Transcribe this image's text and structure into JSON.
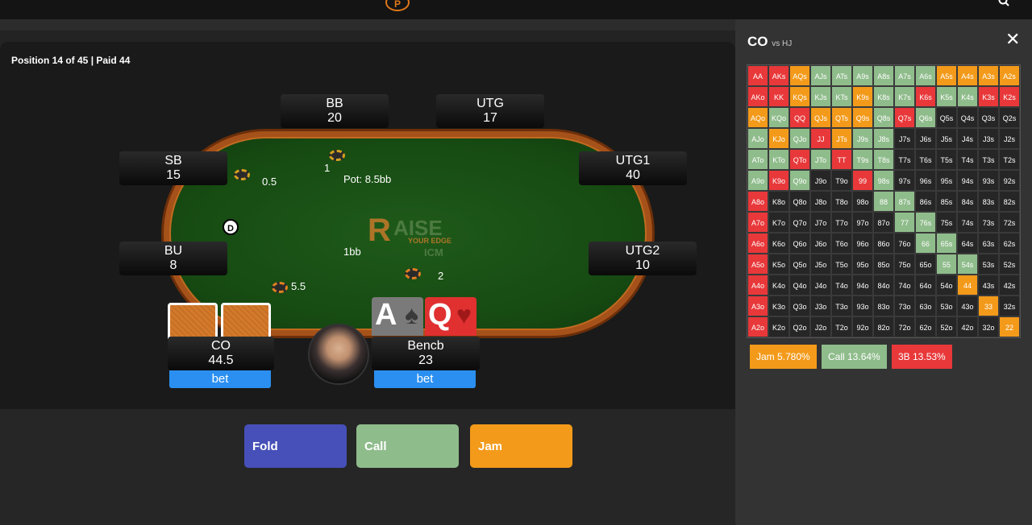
{
  "header": {
    "logo_letter": "P"
  },
  "position_info": "Position 14 of 45  |  Paid 44",
  "pot": "Pot: 8.5bb",
  "dealer": "D",
  "seats": [
    {
      "pos": "BB",
      "stack": "20"
    },
    {
      "pos": "UTG",
      "stack": "17"
    },
    {
      "pos": "SB",
      "stack": "15"
    },
    {
      "pos": "UTG1",
      "stack": "40"
    },
    {
      "pos": "BU",
      "stack": "8"
    },
    {
      "pos": "UTG2",
      "stack": "10"
    },
    {
      "pos": "CO",
      "stack": "44.5"
    },
    {
      "pos": "Bencb",
      "stack": "23"
    }
  ],
  "bets": {
    "bb": "1",
    "sb": "0.5",
    "bu": "5.5",
    "hero": "2",
    "center": "1bb"
  },
  "bet_tags": {
    "co": "bet",
    "hero": "bet"
  },
  "hero_cards": [
    {
      "rank": "A",
      "suit": "♠"
    },
    {
      "rank": "Q",
      "suit": "♥"
    }
  ],
  "brand": {
    "r": "R",
    "word": "AISE",
    "tag": "YOUR EDGE",
    "icm": "ICM"
  },
  "actions": {
    "fold": "Fold",
    "call": "Call",
    "jam": "Jam"
  },
  "colors": {
    "fold": "#4650b8",
    "call": "#8fbc8b",
    "jam": "#f39a1a",
    "threebet": "#e8383a",
    "bet": "#2a8ff0"
  },
  "panel": {
    "title": "CO",
    "subtitle": "vs HJ",
    "close": "✕",
    "legend": {
      "jam": "Jam 5.780%",
      "call": "Call 13.64%",
      "threebet": "3B 13.53%"
    },
    "hands": [
      [
        "AA",
        "AKs",
        "AQs",
        "AJs",
        "ATs",
        "A9s",
        "A8s",
        "A7s",
        "A6s",
        "A5s",
        "A4s",
        "A3s",
        "A2s"
      ],
      [
        "AKo",
        "KK",
        "KQs",
        "KJs",
        "KTs",
        "K9s",
        "K8s",
        "K7s",
        "K6s",
        "K5s",
        "K4s",
        "K3s",
        "K2s"
      ],
      [
        "AQo",
        "KQo",
        "QQ",
        "QJs",
        "QTs",
        "Q9s",
        "Q8s",
        "Q7s",
        "Q6s",
        "Q5s",
        "Q4s",
        "Q3s",
        "Q2s"
      ],
      [
        "AJo",
        "KJo",
        "QJo",
        "JJ",
        "JTs",
        "J9s",
        "J8s",
        "J7s",
        "J6s",
        "J5s",
        "J4s",
        "J3s",
        "J2s"
      ],
      [
        "ATo",
        "KTo",
        "QTo",
        "JTo",
        "TT",
        "T9s",
        "T8s",
        "T7s",
        "T6s",
        "T5s",
        "T4s",
        "T3s",
        "T2s"
      ],
      [
        "A9o",
        "K9o",
        "Q9o",
        "J9o",
        "T9o",
        "99",
        "98s",
        "97s",
        "96s",
        "95s",
        "94s",
        "93s",
        "92s"
      ],
      [
        "A8o",
        "K8o",
        "Q8o",
        "J8o",
        "T8o",
        "98o",
        "88",
        "87s",
        "86s",
        "85s",
        "84s",
        "83s",
        "82s"
      ],
      [
        "A7o",
        "K7o",
        "Q7o",
        "J7o",
        "T7o",
        "97o",
        "87o",
        "77",
        "76s",
        "75s",
        "74s",
        "73s",
        "72s"
      ],
      [
        "A6o",
        "K6o",
        "Q6o",
        "J6o",
        "T6o",
        "96o",
        "86o",
        "76o",
        "66",
        "65s",
        "64s",
        "63s",
        "62s"
      ],
      [
        "A5o",
        "K5o",
        "Q5o",
        "J5o",
        "T5o",
        "95o",
        "85o",
        "75o",
        "65o",
        "55",
        "54s",
        "53s",
        "52s"
      ],
      [
        "A4o",
        "K4o",
        "Q4o",
        "J4o",
        "T4o",
        "94o",
        "84o",
        "74o",
        "64o",
        "54o",
        "44",
        "43s",
        "42s"
      ],
      [
        "A3o",
        "K3o",
        "Q3o",
        "J3o",
        "T3o",
        "93o",
        "83o",
        "73o",
        "63o",
        "53o",
        "43o",
        "33",
        "32s"
      ],
      [
        "A2o",
        "K2o",
        "Q2o",
        "J2o",
        "T2o",
        "92o",
        "82o",
        "72o",
        "62o",
        "52o",
        "42o",
        "32o",
        "22"
      ]
    ],
    "actions_grid": [
      [
        "R",
        "R",
        "O",
        "C",
        "C",
        "C",
        "C",
        "C",
        "C",
        "O",
        "O",
        "O",
        "O"
      ],
      [
        "R",
        "R",
        "O",
        "C",
        "C",
        "O",
        "C",
        "C",
        "R",
        "C",
        "C",
        "R",
        "R"
      ],
      [
        "O",
        "C",
        "R",
        "O",
        "O",
        "O",
        "C",
        "R",
        "C",
        "N",
        "N",
        "N",
        "N"
      ],
      [
        "C",
        "O",
        "C",
        "R",
        "O",
        "C",
        "C",
        "N",
        "N",
        "N",
        "N",
        "N",
        "N"
      ],
      [
        "C",
        "C",
        "R",
        "C",
        "R",
        "C",
        "C",
        "N",
        "N",
        "N",
        "N",
        "N",
        "N"
      ],
      [
        "C",
        "R",
        "C",
        "N",
        "N",
        "R",
        "C",
        "N",
        "N",
        "N",
        "N",
        "N",
        "N"
      ],
      [
        "R",
        "N",
        "N",
        "N",
        "N",
        "N",
        "C",
        "C",
        "N",
        "N",
        "N",
        "N",
        "N"
      ],
      [
        "R",
        "N",
        "N",
        "N",
        "N",
        "N",
        "N",
        "C",
        "C",
        "N",
        "N",
        "N",
        "N"
      ],
      [
        "R",
        "N",
        "N",
        "N",
        "N",
        "N",
        "N",
        "N",
        "C",
        "C",
        "N",
        "N",
        "N"
      ],
      [
        "R",
        "N",
        "N",
        "N",
        "N",
        "N",
        "N",
        "N",
        "N",
        "C",
        "C",
        "N",
        "N"
      ],
      [
        "R",
        "N",
        "N",
        "N",
        "N",
        "N",
        "N",
        "N",
        "N",
        "N",
        "O",
        "N",
        "N"
      ],
      [
        "R",
        "N",
        "N",
        "N",
        "N",
        "N",
        "N",
        "N",
        "N",
        "N",
        "N",
        "O",
        "N"
      ],
      [
        "R",
        "N",
        "N",
        "N",
        "N",
        "N",
        "N",
        "N",
        "N",
        "N",
        "N",
        "N",
        "O"
      ]
    ]
  }
}
